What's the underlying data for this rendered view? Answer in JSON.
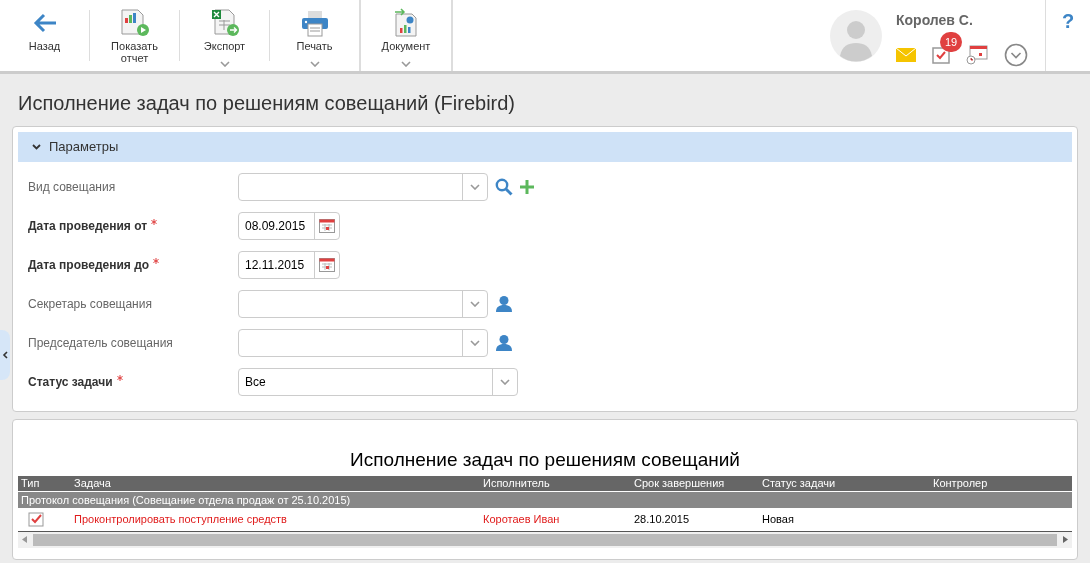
{
  "toolbar": {
    "buttons": [
      {
        "kind": "back",
        "label": "Назад",
        "dropdown": false
      },
      {
        "kind": "report",
        "label": "Показать отчет",
        "dropdown": false
      },
      {
        "kind": "export",
        "label": "Экспорт",
        "dropdown": true
      },
      {
        "kind": "print",
        "label": "Печать",
        "dropdown": true
      },
      {
        "kind": "document",
        "label": "Документ",
        "dropdown": true
      }
    ]
  },
  "user": {
    "name": "Королев С.",
    "tasks_badge": "19"
  },
  "help": "?",
  "page_title": "Исполнение задач по решениям совещаний (Firebird)",
  "parameters": {
    "title": "Параметры",
    "expanded": true,
    "fields": [
      {
        "kind": "combo",
        "label": "Вид совещания",
        "required": false,
        "search_button": true,
        "add_button": true
      },
      {
        "kind": "date",
        "label": "Дата проведения от",
        "required": true,
        "value": "08.09.2015"
      },
      {
        "kind": "date",
        "label": "Дата проведения до",
        "required": true,
        "value": "12.11.2015"
      },
      {
        "kind": "combo",
        "label": "Секретарь совещания",
        "required": false,
        "person_button": true
      },
      {
        "kind": "combo",
        "label": "Председатель совещания",
        "required": false,
        "person_button": true
      },
      {
        "kind": "select",
        "label": "Статус задачи",
        "required": true,
        "value": "Все"
      }
    ]
  },
  "report": {
    "title": "Исполнение задач по решениям совещаний",
    "columns": [
      "Тип",
      "Задача",
      "Исполнитель",
      "Срок завершения",
      "Статус задачи",
      "Контролер"
    ],
    "groups": [
      {
        "title": "Протокол совещания (Совещание отдела продаж от 25.10.2015)",
        "rows": [
          {
            "highlighted": true,
            "task": "Проконтролировать поступление средств",
            "executor": "Коротаев Иван",
            "due": "28.10.2015",
            "status": "Новая"
          }
        ]
      }
    ]
  }
}
